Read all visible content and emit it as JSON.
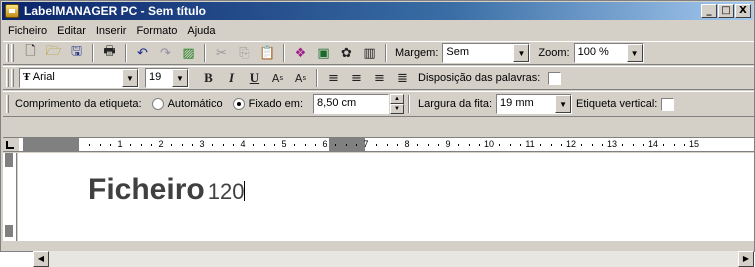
{
  "window": {
    "title": "LabelMANAGER PC - Sem título",
    "buttons": [
      "_",
      "□",
      "X"
    ]
  },
  "menu": [
    "Ficheiro",
    "Editar",
    "Inserir",
    "Formato",
    "Ajuda"
  ],
  "toolbar1": {
    "icons": [
      "new-icon",
      "open-icon",
      "save-icon",
      "print-icon",
      "undo-icon",
      "redo-icon",
      "eraser-icon",
      "cut-icon",
      "copy-icon",
      "paste-icon",
      "symbol-icon",
      "image-icon",
      "clipart-icon",
      "barcode-icon"
    ],
    "margin_label": "Margem:",
    "margin_value": "Sem",
    "zoom_label": "Zoom:",
    "zoom_value": "100 %"
  },
  "toolbar2": {
    "font_value": "Arial",
    "size_value": "19",
    "bold": "B",
    "italic": "I",
    "underline": "U",
    "superscript": "A",
    "superscript_mark": "s",
    "subscript": "A",
    "subscript_mark": "s",
    "wrap_label": "Disposição das palavras:"
  },
  "toolbar3": {
    "length_label": "Comprimento da etiqueta:",
    "auto_label": "Automático",
    "fixed_label": "Fixado em:",
    "fixed_value": "8,50 cm",
    "tape_width_label": "Largura da fita:",
    "tape_width_value": "19 mm",
    "vertical_label": "Etiqueta vertical:"
  },
  "ruler": {
    "ticks": [
      "1",
      "2",
      "3",
      "4",
      "5",
      "6",
      "7",
      "8",
      "9",
      "10",
      "11",
      "12",
      "13",
      "14",
      "15"
    ]
  },
  "editor": {
    "main_text": "Ficheiro",
    "sub_text": "120"
  }
}
